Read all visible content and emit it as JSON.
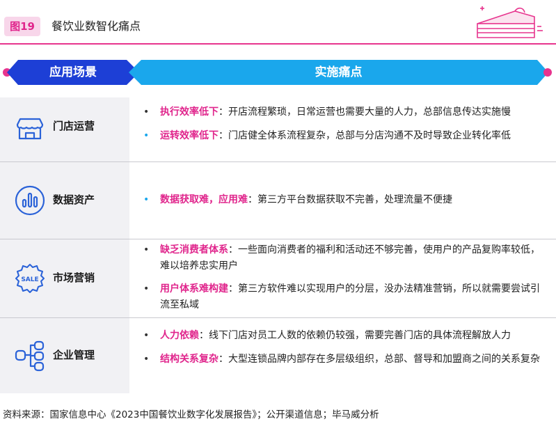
{
  "figure": {
    "label": "图19",
    "title": "餐饮业数智化痛点"
  },
  "table_header": {
    "col_scene": "应用场景",
    "col_pain": "实施痛点"
  },
  "rows": [
    {
      "category": "门店运营",
      "icon": "storefront-icon",
      "points": [
        {
          "keyword": "执行效率低下",
          "sep": "：",
          "text": "开店流程繁琐，日常运营也需要大量的人力，总部信息传达实施慢"
        },
        {
          "keyword": "运转效率低下",
          "sep": "：",
          "text": "门店健全体系流程复杂，总部与分店沟通不及时导致企业转化率低"
        }
      ]
    },
    {
      "category": "数据资产",
      "icon": "bar-chart-icon",
      "points": [
        {
          "keyword": "数据获取难，应用难",
          "sep": "：",
          "text": "第三方平台数据获取不完善，处理流量不便捷"
        }
      ]
    },
    {
      "category": "市场营销",
      "icon": "sale-badge-icon",
      "points": [
        {
          "keyword": "缺乏消费者体系",
          "sep": "：",
          "text": "一些面向消费者的福利和活动还不够完善，使用户的产品复购率较低，难以培养忠实用户"
        },
        {
          "keyword": "用户体系难构建",
          "sep": "：",
          "text": "第三方软件难以实现用户的分层，没办法精准营销，所以就需要尝试引流至私域"
        }
      ]
    },
    {
      "category": "企业管理",
      "icon": "org-structure-icon",
      "points": [
        {
          "keyword": "人力依赖",
          "sep": "：",
          "text": "线下门店对员工人数的依赖仍较强，需要完善门店的具体流程解放人力"
        },
        {
          "keyword": "结构关系复杂",
          "sep": "：",
          "text": "大型连锁品牌内部存在多层级组织，总部、督导和加盟商之间的关系复杂"
        }
      ]
    }
  ],
  "source": "资料来源：国家信息中心《2023中国餐饮业数字化发展报告》；公开渠道信息；毕马威分析",
  "colors": {
    "accent_pink": "#e7348e",
    "header_blue": "#1d3fd6",
    "header_cyan": "#1aa7ec",
    "icon_blue": "#2a62d8"
  }
}
